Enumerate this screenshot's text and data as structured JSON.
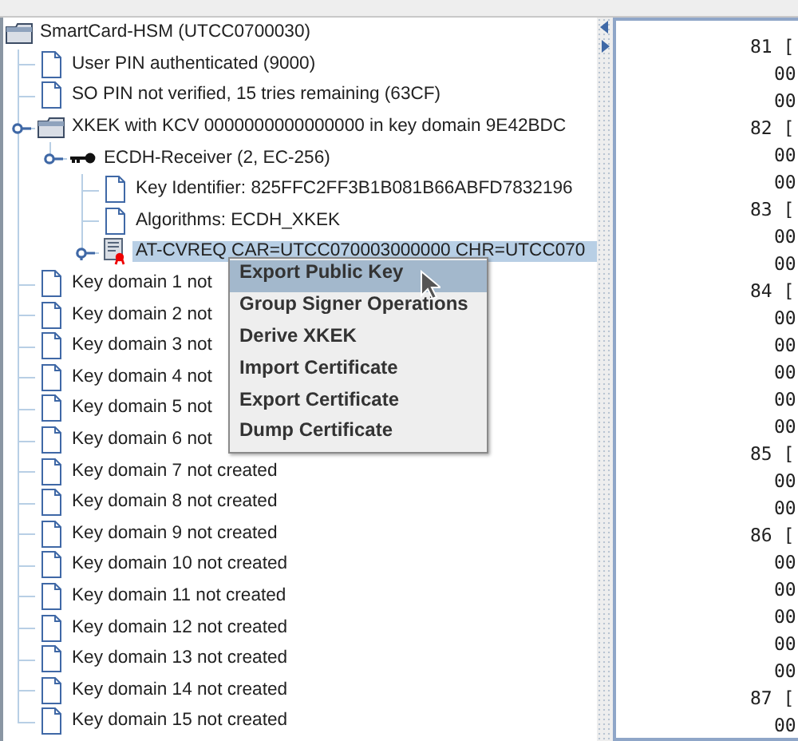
{
  "tree": {
    "label": "SmartCard-HSM (UTCC0700030)",
    "kind": "folder",
    "selected": false,
    "children": [
      {
        "label": "User PIN authenticated (9000)",
        "kind": "document",
        "selected": false
      },
      {
        "label": "SO PIN not verified, 15 tries remaining (63CF)",
        "kind": "document",
        "selected": false
      },
      {
        "label": "XKEK with KCV 0000000000000000 in key domain 9E42BDC",
        "kind": "folder",
        "selected": false,
        "expanded": true,
        "children": [
          {
            "label": "ECDH-Receiver (2, EC-256)",
            "kind": "key",
            "selected": false,
            "expanded": true,
            "children": [
              {
                "label": "Key Identifier: 825FFC2FF3B1B081B66ABFD7832196",
                "kind": "document",
                "selected": false
              },
              {
                "label": "Algorithms: ECDH_XKEK",
                "kind": "document",
                "selected": false
              },
              {
                "label": "AT-CVREQ CAR=UTCC070003000000 CHR=UTCC070",
                "kind": "certificate",
                "selected": true,
                "expanded": false
              }
            ]
          }
        ]
      },
      {
        "label": "Key domain 1 not",
        "kind": "document",
        "selected": false
      },
      {
        "label": "Key domain 2 not",
        "kind": "document",
        "selected": false
      },
      {
        "label": "Key domain 3 not",
        "kind": "document",
        "selected": false
      },
      {
        "label": "Key domain 4 not",
        "kind": "document",
        "selected": false
      },
      {
        "label": "Key domain 5 not",
        "kind": "document",
        "selected": false
      },
      {
        "label": "Key domain 6 not",
        "kind": "document",
        "selected": false
      },
      {
        "label": "Key domain 7 not created",
        "kind": "document",
        "selected": false
      },
      {
        "label": "Key domain 8 not created",
        "kind": "document",
        "selected": false
      },
      {
        "label": "Key domain 9 not created",
        "kind": "document",
        "selected": false
      },
      {
        "label": "Key domain 10 not created",
        "kind": "document",
        "selected": false
      },
      {
        "label": "Key domain 11 not created",
        "kind": "document",
        "selected": false
      },
      {
        "label": "Key domain 12 not created",
        "kind": "document",
        "selected": false
      },
      {
        "label": "Key domain 13 not created",
        "kind": "document",
        "selected": false
      },
      {
        "label": "Key domain 14 not created",
        "kind": "document",
        "selected": false
      },
      {
        "label": "Key domain 15 not created",
        "kind": "document",
        "selected": false
      }
    ]
  },
  "context_menu": {
    "items": [
      {
        "label": "Export Public Key",
        "selected": true
      },
      {
        "label": "Group Signer Operations",
        "selected": false
      },
      {
        "label": "Derive XKEK",
        "selected": false
      },
      {
        "label": "Import Certificate",
        "selected": false
      },
      {
        "label": "Export Certificate",
        "selected": false
      },
      {
        "label": "Dump Certificate",
        "selected": false
      }
    ]
  },
  "hex_lines": [
    {
      "kind": "header",
      "text": "81 ["
    },
    {
      "kind": "byte",
      "text": "00"
    },
    {
      "kind": "byte",
      "text": "00"
    },
    {
      "kind": "header",
      "text": "82 ["
    },
    {
      "kind": "byte",
      "text": "00"
    },
    {
      "kind": "byte",
      "text": "00"
    },
    {
      "kind": "header",
      "text": "83 ["
    },
    {
      "kind": "byte",
      "text": "00"
    },
    {
      "kind": "byte",
      "text": "00"
    },
    {
      "kind": "header",
      "text": "84 ["
    },
    {
      "kind": "byte",
      "text": "00"
    },
    {
      "kind": "byte",
      "text": "00"
    },
    {
      "kind": "byte",
      "text": "00"
    },
    {
      "kind": "byte",
      "text": "00"
    },
    {
      "kind": "byte",
      "text": "00"
    },
    {
      "kind": "header",
      "text": "85 ["
    },
    {
      "kind": "byte",
      "text": "00"
    },
    {
      "kind": "byte",
      "text": "00"
    },
    {
      "kind": "header",
      "text": "86 ["
    },
    {
      "kind": "byte",
      "text": "00"
    },
    {
      "kind": "byte",
      "text": "00"
    },
    {
      "kind": "byte",
      "text": "00"
    },
    {
      "kind": "byte",
      "text": "00"
    },
    {
      "kind": "byte",
      "text": "00"
    },
    {
      "kind": "header",
      "text": "87 ["
    },
    {
      "kind": "byte",
      "text": "00"
    }
  ]
}
